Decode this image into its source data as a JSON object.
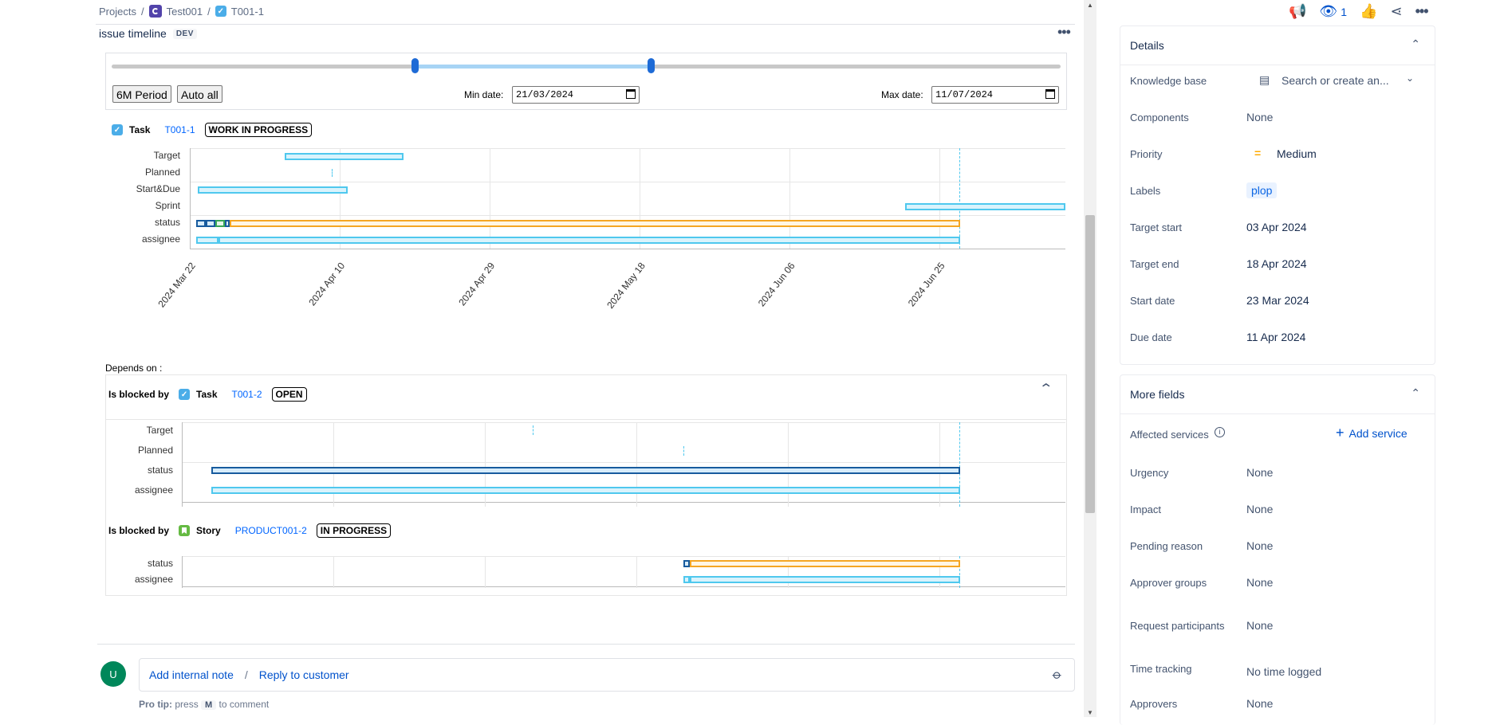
{
  "breadcrumbs": {
    "projects": "Projects",
    "project": "Test001",
    "issue": "T001-1"
  },
  "timeline": {
    "title": "issue timeline",
    "badge": "DEV",
    "more": "•••",
    "btn_period": "6M Period",
    "btn_auto": "Auto all",
    "min_label": "Min date:",
    "min_value": "21/03/2024",
    "max_label": "Max date:",
    "max_value": "11/07/2024",
    "main_issue": {
      "type": "Task",
      "key": "T001-1",
      "status": "WORK IN PROGRESS"
    },
    "main_rows": [
      "Target",
      "Planned",
      "Start&Due",
      "Sprint",
      "status",
      "assignee"
    ],
    "x_ticks": [
      "2024 Mar 22",
      "2024 Apr 10",
      "2024 Apr 29",
      "2024 May 18",
      "2024 Jun 06",
      "2024 Jun 25"
    ],
    "depends_label": "Depends on :",
    "dep1": {
      "rel": "Is blocked by",
      "type": "Task",
      "key": "T001-2",
      "status": "OPEN",
      "rows": [
        "Target",
        "Planned",
        "status",
        "assignee"
      ]
    },
    "dep2": {
      "rel": "Is blocked by",
      "type": "Story",
      "key": "PRODUCT001-2",
      "status": "IN PROGRESS",
      "rows": [
        "status",
        "assignee"
      ]
    }
  },
  "comment": {
    "avatar": "U",
    "add_note": "Add internal note",
    "slash": "/",
    "reply": "Reply to customer",
    "protip_bold": "Pro tip:",
    "protip_press": "press",
    "protip_key": "M",
    "protip_rest": "to comment"
  },
  "top_actions": {
    "watch_count": "1"
  },
  "details": {
    "title": "Details",
    "fields": [
      {
        "label": "Knowledge base",
        "value": "Search or create an..."
      },
      {
        "label": "Components",
        "value": "None"
      },
      {
        "label": "Priority",
        "value": "Medium"
      },
      {
        "label": "Labels",
        "value": "plop"
      },
      {
        "label": "Target start",
        "value": "03 Apr 2024"
      },
      {
        "label": "Target end",
        "value": "18 Apr 2024"
      },
      {
        "label": "Start date",
        "value": "23 Mar 2024"
      },
      {
        "label": "Due date",
        "value": "11 Apr 2024"
      }
    ]
  },
  "more_fields": {
    "title": "More fields",
    "affected_label": "Affected services",
    "add_service": "Add service",
    "fields": [
      {
        "label": "Urgency",
        "value": "None"
      },
      {
        "label": "Impact",
        "value": "None"
      },
      {
        "label": "Pending reason",
        "value": "None"
      },
      {
        "label": "Approver groups",
        "value": "None"
      },
      {
        "label": "Request participants",
        "value": "None"
      },
      {
        "label": "Time tracking",
        "value": "No time logged"
      },
      {
        "label": "Approvers",
        "value": "None"
      }
    ]
  },
  "colors": {
    "accent": "#0052cc",
    "bar_cyan": "#4fc8ee",
    "bar_orange": "#f5a623",
    "bar_navy": "#175b9e",
    "bar_green": "#3aa757"
  }
}
